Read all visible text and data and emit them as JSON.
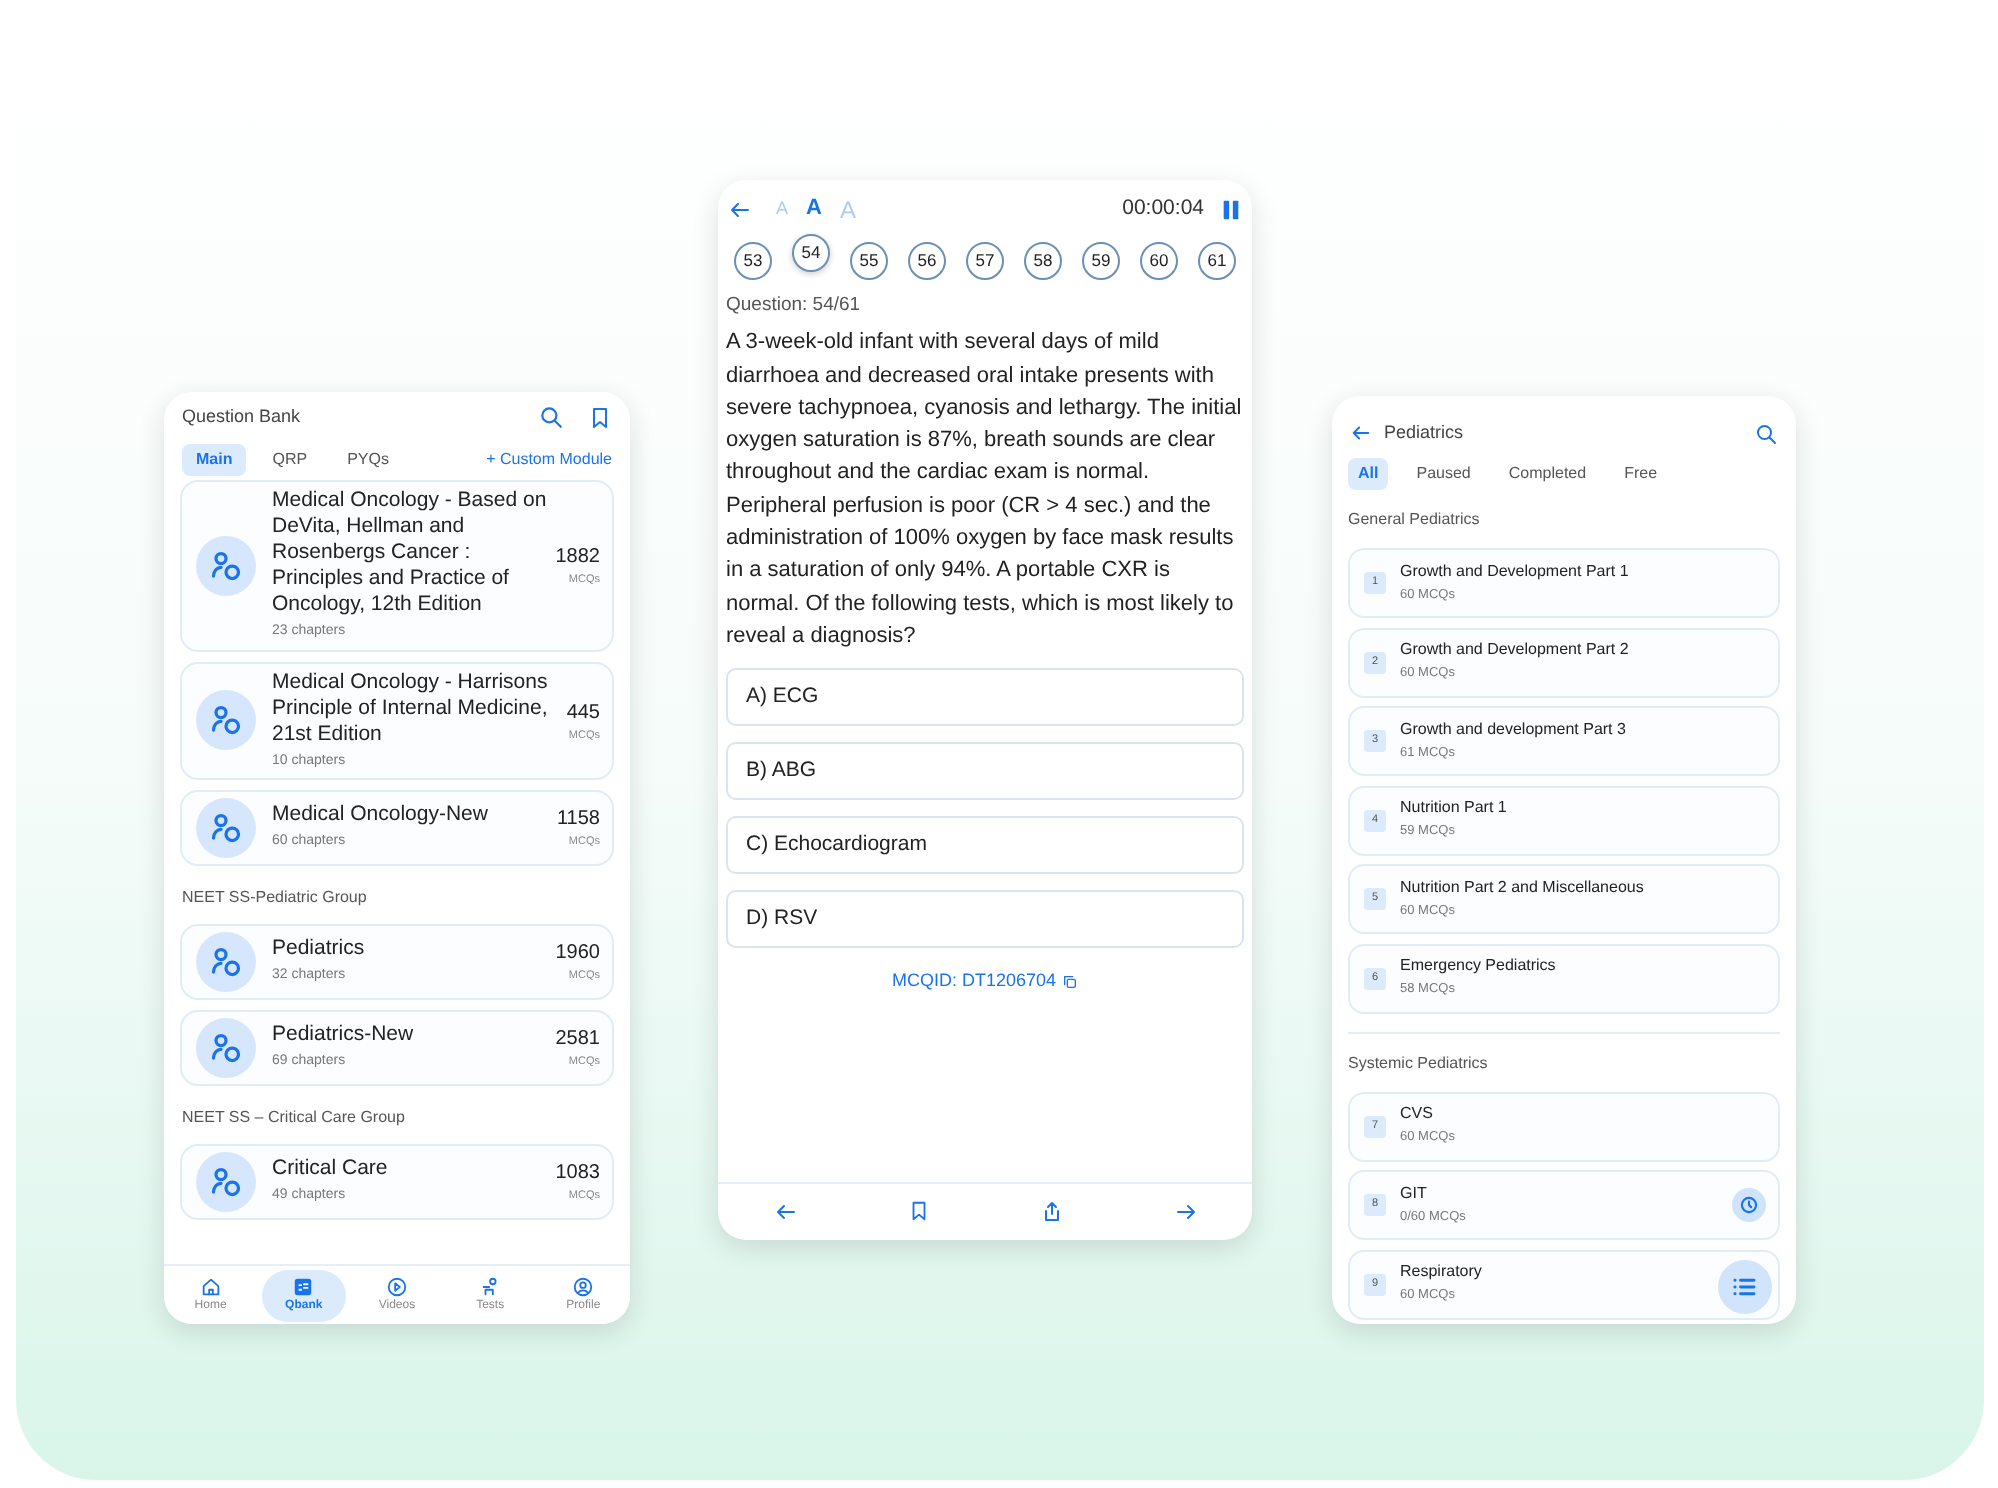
{
  "question_bank": {
    "title": "Question Bank",
    "tabs": [
      {
        "label": "Main",
        "selected": true
      },
      {
        "label": "QRP",
        "selected": false
      },
      {
        "label": "PYQs",
        "selected": false
      }
    ],
    "custom_module_link": "+ Custom Module",
    "list": [
      {
        "kind": "card",
        "title": "Medical Oncology - Based on DeVita, Hellman and Rosenbergs Cancer : Principles and Practice of Oncology, 12th Edition",
        "chapters": "23 chapters",
        "count": "1882",
        "unit": "MCQs"
      },
      {
        "kind": "card",
        "title": "Medical Oncology - Harrisons Principle of Internal Medicine, 21st Edition",
        "chapters": "10 chapters",
        "count": "445",
        "unit": "MCQs"
      },
      {
        "kind": "card",
        "title": "Medical Oncology-New",
        "chapters": "60 chapters",
        "count": "1158",
        "unit": "MCQs"
      },
      {
        "kind": "section",
        "label": "NEET SS-Pediatric Group"
      },
      {
        "kind": "card",
        "title": "Pediatrics",
        "chapters": "32 chapters",
        "count": "1960",
        "unit": "MCQs"
      },
      {
        "kind": "card",
        "title": "Pediatrics-New",
        "chapters": "69 chapters",
        "count": "2581",
        "unit": "MCQs"
      },
      {
        "kind": "section",
        "label": "NEET SS – Critical Care Group"
      },
      {
        "kind": "card",
        "title": "Critical Care",
        "chapters": "49 chapters",
        "count": "1083",
        "unit": "MCQs"
      }
    ],
    "nav": [
      {
        "label": "Home",
        "selected": false
      },
      {
        "label": "Qbank",
        "selected": true
      },
      {
        "label": "Videos",
        "selected": false
      },
      {
        "label": "Tests",
        "selected": false
      },
      {
        "label": "Profile",
        "selected": false
      }
    ]
  },
  "question": {
    "font_sizes": [
      {
        "label": "A",
        "selected": false
      },
      {
        "label": "A",
        "selected": true
      },
      {
        "label": "A",
        "selected": false
      }
    ],
    "timer": "00:00:04",
    "question_numbers": [
      {
        "label": "53",
        "selected": false
      },
      {
        "label": "54",
        "selected": true
      },
      {
        "label": "55",
        "selected": false
      },
      {
        "label": "56",
        "selected": false
      },
      {
        "label": "57",
        "selected": false
      },
      {
        "label": "58",
        "selected": false
      },
      {
        "label": "59",
        "selected": false
      },
      {
        "label": "60",
        "selected": false
      },
      {
        "label": "61",
        "selected": false
      }
    ],
    "question_label": "Question: 54/61",
    "question_text": "A 3-week-old infant with several days of mild diarrhoea and decreased oral intake presents with severe tachypnoea, cyanosis and lethargy. The initial oxygen saturation is 87%, breath sounds are clear throughout and the cardiac exam is normal. Peripheral perfusion is poor (CR > 4 sec.) and the administration of 100% oxygen by face mask results in a saturation of only 94%. A portable CXR is normal. Of the following tests, which is most likely to reveal a diagnosis?",
    "options": [
      "A) ECG",
      "B) ABG",
      "C) Echocardiogram",
      "D) RSV"
    ],
    "mcq_id": "MCQID: DT1206704"
  },
  "chapters": {
    "title": "Pediatrics",
    "filters": [
      {
        "label": "All",
        "selected": true
      },
      {
        "label": "Paused",
        "selected": false
      },
      {
        "label": "Completed",
        "selected": false
      },
      {
        "label": "Free",
        "selected": false
      }
    ],
    "sections": [
      {
        "label": "General Pediatrics",
        "items": [
          {
            "number": "1",
            "title": "Growth and Development Part 1",
            "subtitle": "60 MCQs",
            "in_progress": false
          },
          {
            "number": "2",
            "title": "Growth and Development Part 2",
            "subtitle": "60 MCQs",
            "in_progress": false
          },
          {
            "number": "3",
            "title": "Growth and development Part 3",
            "subtitle": "61 MCQs",
            "in_progress": false
          },
          {
            "number": "4",
            "title": "Nutrition Part 1",
            "subtitle": "59 MCQs",
            "in_progress": false
          },
          {
            "number": "5",
            "title": "Nutrition Part 2 and Miscellaneous",
            "subtitle": "60 MCQs",
            "in_progress": false
          },
          {
            "number": "6",
            "title": "Emergency Pediatrics",
            "subtitle": "58 MCQs",
            "in_progress": false
          }
        ]
      },
      {
        "label": "Systemic Pediatrics",
        "items": [
          {
            "number": "7",
            "title": "CVS",
            "subtitle": "60 MCQs",
            "in_progress": false
          },
          {
            "number": "8",
            "title": "GIT",
            "subtitle": "0/60 MCQs",
            "in_progress": true
          },
          {
            "number": "9",
            "title": "Respiratory",
            "subtitle": "60 MCQs",
            "in_progress": false
          }
        ]
      }
    ]
  }
}
